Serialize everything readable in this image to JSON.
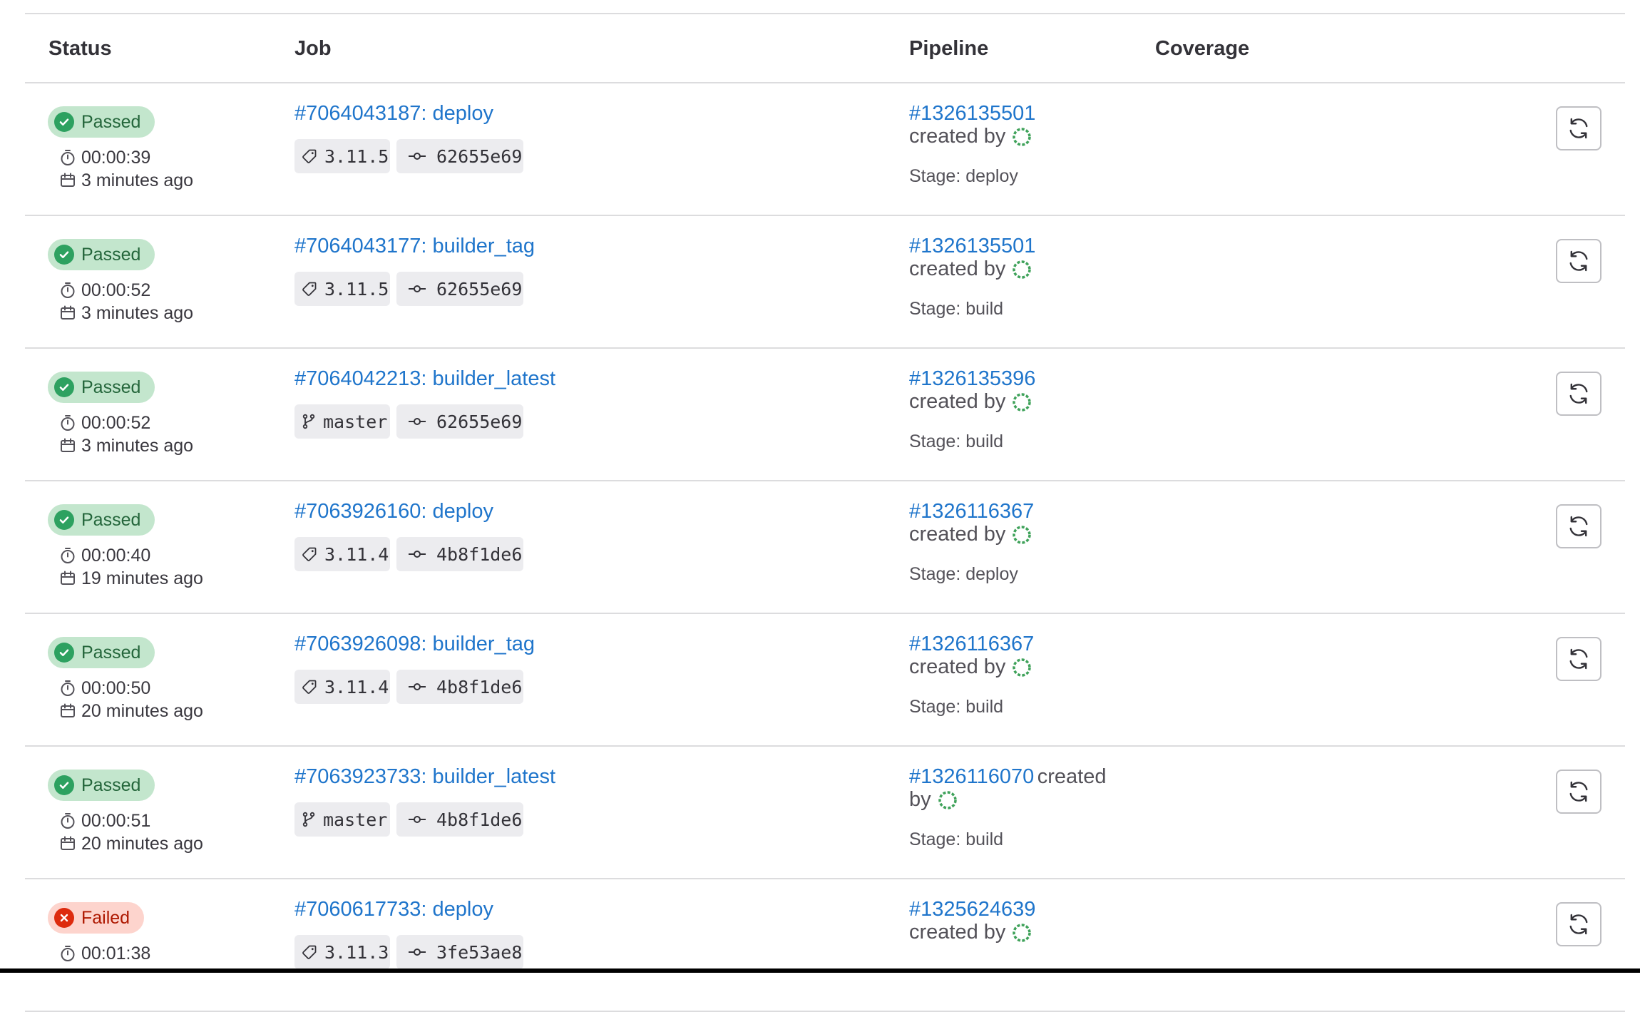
{
  "headers": {
    "status": "Status",
    "job": "Job",
    "pipeline": "Pipeline",
    "coverage": "Coverage"
  },
  "colors": {
    "link": "#1f75cb",
    "success_bg": "#c3e6cd",
    "success_fg": "#24663b",
    "failed_bg": "#fdd4cd",
    "failed_fg": "#ae1800"
  },
  "rows": [
    {
      "status": "Passed",
      "status_kind": "success",
      "duration": "00:00:39",
      "finished": "3 minutes ago",
      "job": "#7064043187: deploy",
      "ref_type": "tag",
      "ref": "3.11.5",
      "sha": "62655e69",
      "pipeline": "#1326135501",
      "created_by": "created by",
      "stage": "Stage: deploy"
    },
    {
      "status": "Passed",
      "status_kind": "success",
      "duration": "00:00:52",
      "finished": "3 minutes ago",
      "job": "#7064043177: builder_tag",
      "ref_type": "tag",
      "ref": "3.11.5",
      "sha": "62655e69",
      "pipeline": "#1326135501",
      "created_by": "created by",
      "stage": "Stage: build"
    },
    {
      "status": "Passed",
      "status_kind": "success",
      "duration": "00:00:52",
      "finished": "3 minutes ago",
      "job": "#7064042213: builder_latest",
      "ref_type": "branch",
      "ref": "master",
      "sha": "62655e69",
      "pipeline": "#1326135396",
      "created_by": "created by",
      "stage": "Stage: build"
    },
    {
      "status": "Passed",
      "status_kind": "success",
      "duration": "00:00:40",
      "finished": "19 minutes ago",
      "job": "#7063926160: deploy",
      "ref_type": "tag",
      "ref": "3.11.4",
      "sha": "4b8f1de6",
      "pipeline": "#1326116367",
      "created_by": "created by",
      "stage": "Stage: deploy"
    },
    {
      "status": "Passed",
      "status_kind": "success",
      "duration": "00:00:50",
      "finished": "20 minutes ago",
      "job": "#7063926098: builder_tag",
      "ref_type": "tag",
      "ref": "3.11.4",
      "sha": "4b8f1de6",
      "pipeline": "#1326116367",
      "created_by": "created by",
      "stage": "Stage: build"
    },
    {
      "status": "Passed",
      "status_kind": "success",
      "duration": "00:00:51",
      "finished": "20 minutes ago",
      "job": "#7063923733: builder_latest",
      "ref_type": "branch",
      "ref": "master",
      "sha": "4b8f1de6",
      "pipeline": "#1326116070",
      "created_by": "created",
      "created_by_wrap": "by",
      "stage": "Stage: build"
    },
    {
      "status": "Failed",
      "status_kind": "failed",
      "duration": "00:01:38",
      "finished": "",
      "job": "#7060617733: deploy",
      "ref_type": "tag",
      "ref": "3.11.3",
      "sha": "3fe53ae8",
      "pipeline": "#1325624639",
      "created_by": "created by",
      "stage": ""
    }
  ]
}
